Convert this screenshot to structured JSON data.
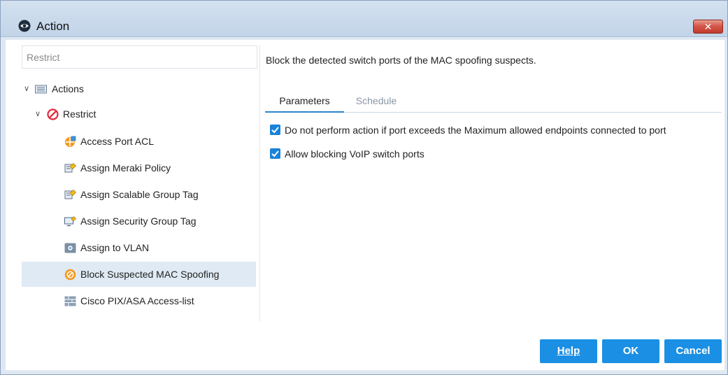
{
  "window": {
    "title": "Action",
    "close_label": "✕"
  },
  "tree": {
    "search_placeholder": "Restrict",
    "root": {
      "label": "Actions"
    },
    "group": {
      "label": "Restrict"
    },
    "items": [
      {
        "label": "Access Port ACL",
        "icon": "acl-icon"
      },
      {
        "label": "Assign Meraki Policy",
        "icon": "policy-tag-icon"
      },
      {
        "label": "Assign Scalable Group Tag",
        "icon": "policy-tag-icon"
      },
      {
        "label": "Assign Security Group Tag",
        "icon": "monitor-tag-icon"
      },
      {
        "label": "Assign to VLAN",
        "icon": "vlan-icon"
      },
      {
        "label": "Block Suspected MAC Spoofing",
        "icon": "block-spoof-icon",
        "selected": true
      },
      {
        "label": "Cisco PIX/ASA Access-list",
        "icon": "firewall-grid-icon"
      }
    ]
  },
  "detail": {
    "description": "Block the detected switch ports of the MAC spoofing suspects.",
    "tabs": [
      {
        "label": "Parameters",
        "active": true
      },
      {
        "label": "Schedule",
        "active": false
      }
    ],
    "options": [
      {
        "label": "Do not perform action if port exceeds the Maximum allowed endpoints connected to port",
        "checked": true
      },
      {
        "label": "Allow blocking VoIP switch ports",
        "checked": true
      }
    ]
  },
  "buttons": {
    "help_label": "Help",
    "ok_label": "OK",
    "cancel_label": "Cancel"
  },
  "colors": {
    "accent": "#1a8fe3",
    "selected_row": "#dfeaf4",
    "close": "#c13b2c"
  }
}
